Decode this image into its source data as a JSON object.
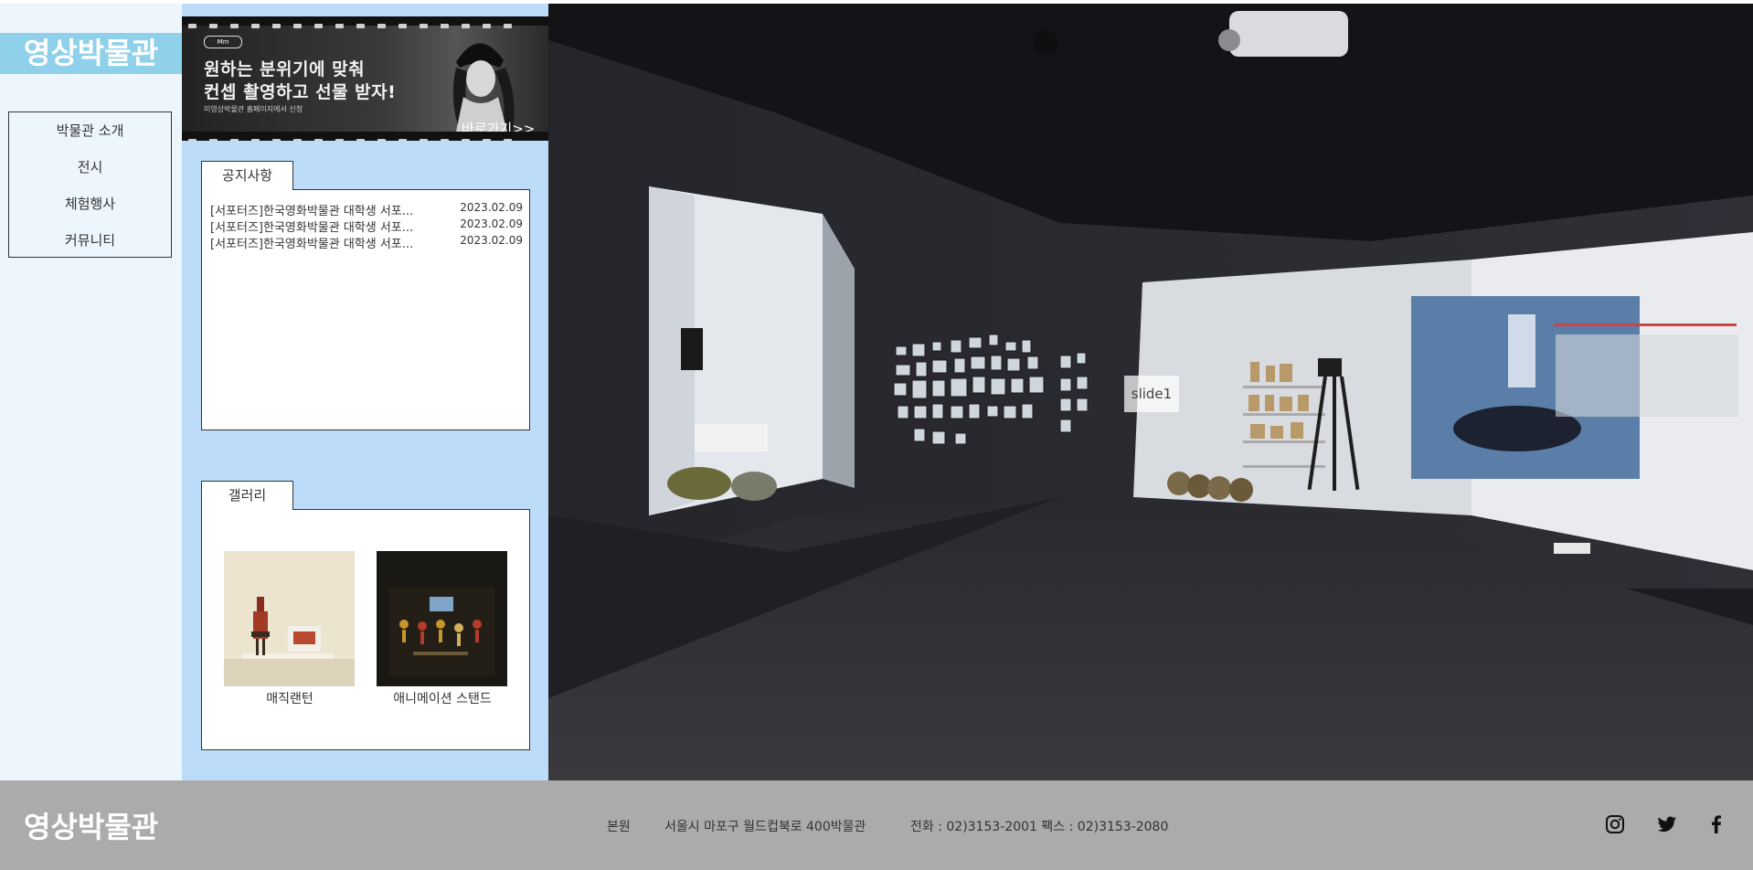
{
  "site": {
    "logo": "영상박물관"
  },
  "nav": {
    "items": [
      {
        "label": "박물관 소개"
      },
      {
        "label": "전시"
      },
      {
        "label": "체험행사"
      },
      {
        "label": "커뮤니티"
      }
    ]
  },
  "banner": {
    "badge": "Mm",
    "line1": "원하는 분위기에 맞춰",
    "line2": "컨셉 촬영하고 선물 받자!",
    "small": "미영상박물관 홈페이지에서 신청",
    "go_label": "바로가기>>"
  },
  "notice": {
    "tab_label": "공지사항",
    "items": [
      {
        "title": "[서포터즈]한국영화박물관 대학생 서포...",
        "date": "2023.02.09"
      },
      {
        "title": "[서포터즈]한국영화박물관 대학생 서포...",
        "date": "2023.02.09"
      },
      {
        "title": "[서포터즈]한국영화박물관 대학생 서포...",
        "date": "2023.02.09"
      }
    ]
  },
  "gallery": {
    "tab_label": "갤러리",
    "items": [
      {
        "label": "매직랜턴"
      },
      {
        "label": "애니메이션 스탠드"
      }
    ]
  },
  "hero": {
    "slide_label": "slide1"
  },
  "footer": {
    "logo": "영상박물관",
    "branch": "본원",
    "address": "서울시 마포구 월드컵북로 400박물관",
    "contact": "전화 : 02)3153-2001 팩스 : 02)3153-2080",
    "social": [
      "instagram-icon",
      "twitter-icon",
      "facebook-icon"
    ]
  },
  "colors": {
    "logo_bg": "#8fd0ea",
    "left_bg": "#eef6fd",
    "mid_bg": "#bcdcfa",
    "footer_bg": "#ababab"
  }
}
